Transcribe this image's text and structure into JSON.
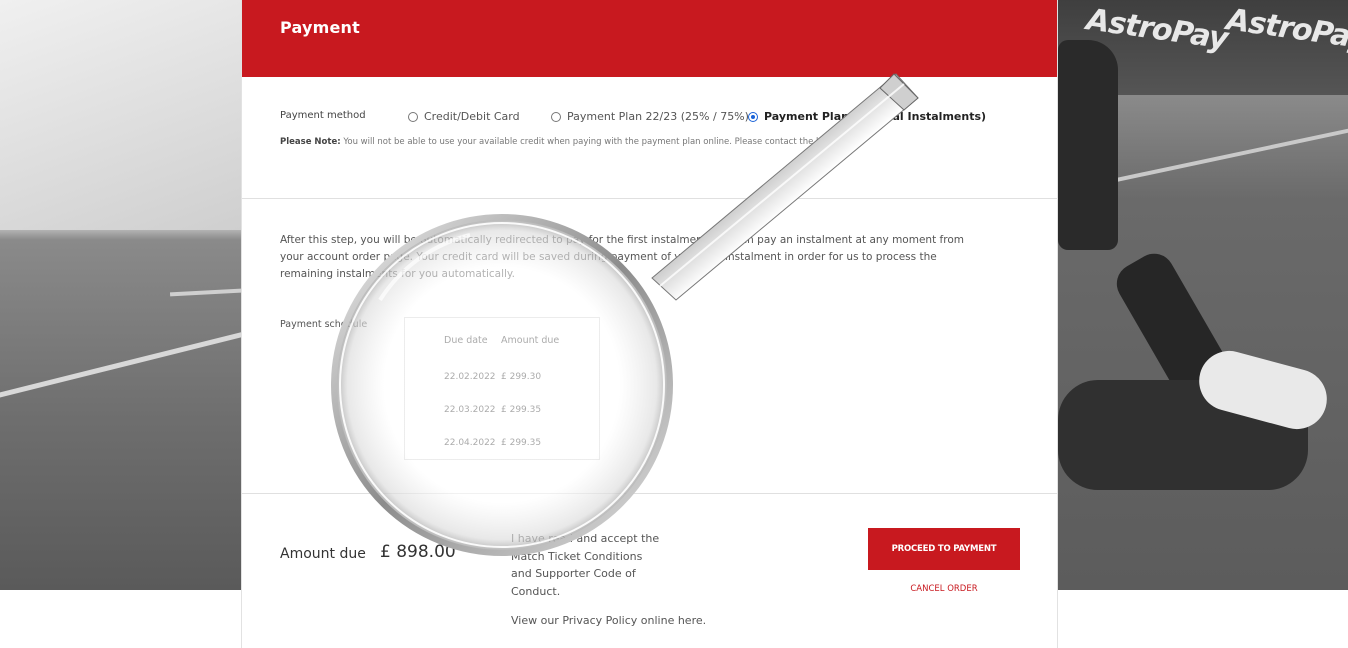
{
  "background": {
    "brand_text": "AstroPay"
  },
  "header": {
    "title": "Payment"
  },
  "payment_method": {
    "label": "Payment method",
    "options": [
      {
        "label": "Credit/Debit Card",
        "selected": false
      },
      {
        "label": "Payment Plan 22/23 (25% / 75%)",
        "selected": false
      },
      {
        "label": "Payment Plan (3 Equal Instalments)",
        "selected": true
      }
    ],
    "note_prefix": "Please Note:",
    "note_text": "You will not be able to use your available credit when paying with the payment plan online. Please contact the box office"
  },
  "info": {
    "text": "After this step, you will be automatically redirected to pay for the first instalment. You can pay an instalment at any moment from your account order page. Your credit card will be saved during payment of your first instalment in order for us to process the remaining instalments for you automatically."
  },
  "schedule": {
    "label": "Payment schedule",
    "headers": [
      "Due date",
      "Amount due"
    ],
    "rows": [
      {
        "date": "22.02.2022",
        "amount": "£ 299.30"
      },
      {
        "date": "22.03.2022",
        "amount": "£ 299.35"
      },
      {
        "date": "22.04.2022",
        "amount": "£ 299.35"
      }
    ]
  },
  "summary": {
    "amount_label": "Amount due",
    "amount_value": "£ 898.00",
    "terms_text": "I have read and accept the Match Ticket Conditions and Supporter Code of Conduct.",
    "privacy_text": "View our Privacy Policy online here.",
    "proceed_label": "Proceed to payment",
    "cancel_label": "Cancel order"
  },
  "colors": {
    "accent": "#c8191f",
    "radio_selected": "#1a63d8"
  }
}
